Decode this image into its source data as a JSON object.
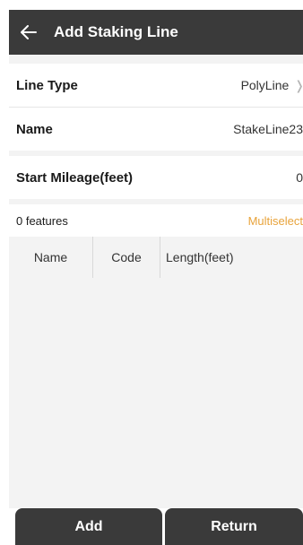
{
  "header": {
    "back_icon": "arrow-left-icon",
    "title": "Add Staking Line"
  },
  "form": {
    "line_type": {
      "label": "Line Type",
      "value": "PolyLine"
    },
    "name": {
      "label": "Name",
      "value": "StakeLine23"
    },
    "start_mileage": {
      "label": "Start Mileage(feet)",
      "value": "0"
    }
  },
  "features": {
    "count_label": "0 features",
    "multiselect_label": "Multiselect",
    "columns": [
      "Name",
      "Code",
      "Length(feet)"
    ],
    "rows": []
  },
  "footer": {
    "add_label": "Add",
    "return_label": "Return"
  },
  "colors": {
    "appbar": "#3a3a3a",
    "accent": "#e8a33b",
    "background": "#f3f3f3"
  }
}
